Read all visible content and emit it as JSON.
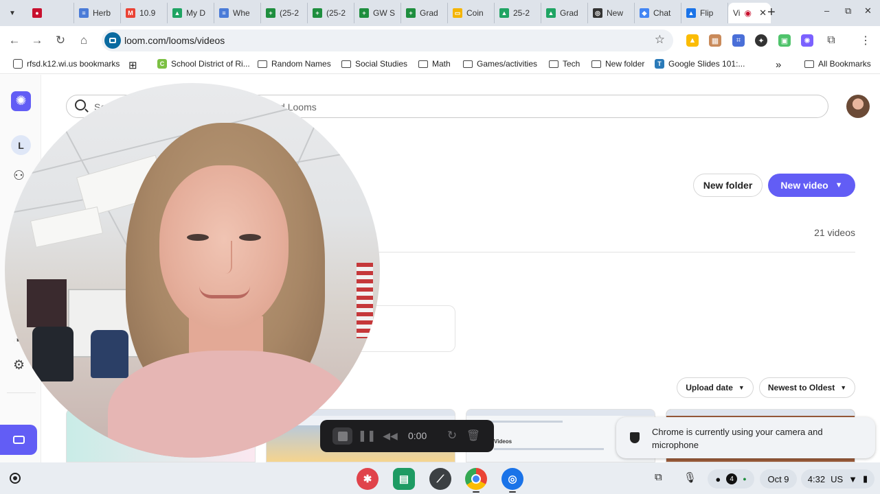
{
  "browser": {
    "tabs": [
      {
        "title": "",
        "icon": "record-icon",
        "color": "#c8102e"
      },
      {
        "title": "Herb",
        "icon": "docs-icon",
        "color": "#4a7bd8"
      },
      {
        "title": "10.9",
        "icon": "gmail-icon",
        "color": "#ea4335"
      },
      {
        "title": "My D",
        "icon": "drive-icon",
        "color": "#1fa463"
      },
      {
        "title": "Whe",
        "icon": "docs-icon",
        "color": "#4a7bd8"
      },
      {
        "title": "(25-2",
        "icon": "sheets-icon",
        "color": "#1e8e3e"
      },
      {
        "title": "(25-2",
        "icon": "sheets-icon",
        "color": "#1e8e3e"
      },
      {
        "title": "GW S",
        "icon": "sheets-icon",
        "color": "#1e8e3e"
      },
      {
        "title": "Grad",
        "icon": "sheets-icon",
        "color": "#1e8e3e"
      },
      {
        "title": "Coin",
        "icon": "slides-icon",
        "color": "#f4b400"
      },
      {
        "title": "25-2",
        "icon": "drive-icon",
        "color": "#1fa463"
      },
      {
        "title": "Grad",
        "icon": "drive-icon",
        "color": "#1fa463"
      },
      {
        "title": "New",
        "icon": "chatgpt-icon",
        "color": "#333333"
      },
      {
        "title": "Chat",
        "icon": "chat-icon",
        "color": "#4285f4"
      },
      {
        "title": "Flip",
        "icon": "flip-icon",
        "color": "#1a73e8"
      }
    ],
    "active_tab": {
      "title": "Vi",
      "close": "✕"
    },
    "new_tab": "+",
    "window_controls": {
      "minimize": "–",
      "maximize": "⧉",
      "close": "✕"
    },
    "url": "loom.com/looms/videos",
    "bookmarks": [
      {
        "label": "rfsd.k12.wi.us bookmarks",
        "type": "icon"
      },
      {
        "label": "",
        "type": "apps"
      },
      {
        "label": "School District of Ri...",
        "type": "icon"
      },
      {
        "label": "Random Names",
        "type": "folder"
      },
      {
        "label": "Social Studies",
        "type": "folder"
      },
      {
        "label": "Math",
        "type": "folder"
      },
      {
        "label": "Games/activities",
        "type": "folder"
      },
      {
        "label": "Tech",
        "type": "folder"
      },
      {
        "label": "New folder",
        "type": "folder"
      },
      {
        "label": "Google Slides 101:...",
        "type": "icon"
      }
    ],
    "bookmarks_overflow": "»",
    "all_bookmarks": "All Bookmarks"
  },
  "loom": {
    "workspace_initial": "L",
    "search_placeholder": "Search for people, tags, folders, spaces, and Looms",
    "new_folder": "New folder",
    "new_video": "New video",
    "video_count": "21 videos",
    "sort_by": "Upload date",
    "sort_order": "Newest to Oldest",
    "thumb_label": "Videos"
  },
  "recording": {
    "timer": "0:00"
  },
  "notification": {
    "text": "Chrome is currently using your camera and microphone"
  },
  "shelf": {
    "tray_count": "4",
    "date": "Oct 9",
    "time": "4:32",
    "locale": "US"
  },
  "colors": {
    "loom_accent": "#625df5",
    "tabstrip": "#dee3ea",
    "shelf": "#e9edf2"
  }
}
